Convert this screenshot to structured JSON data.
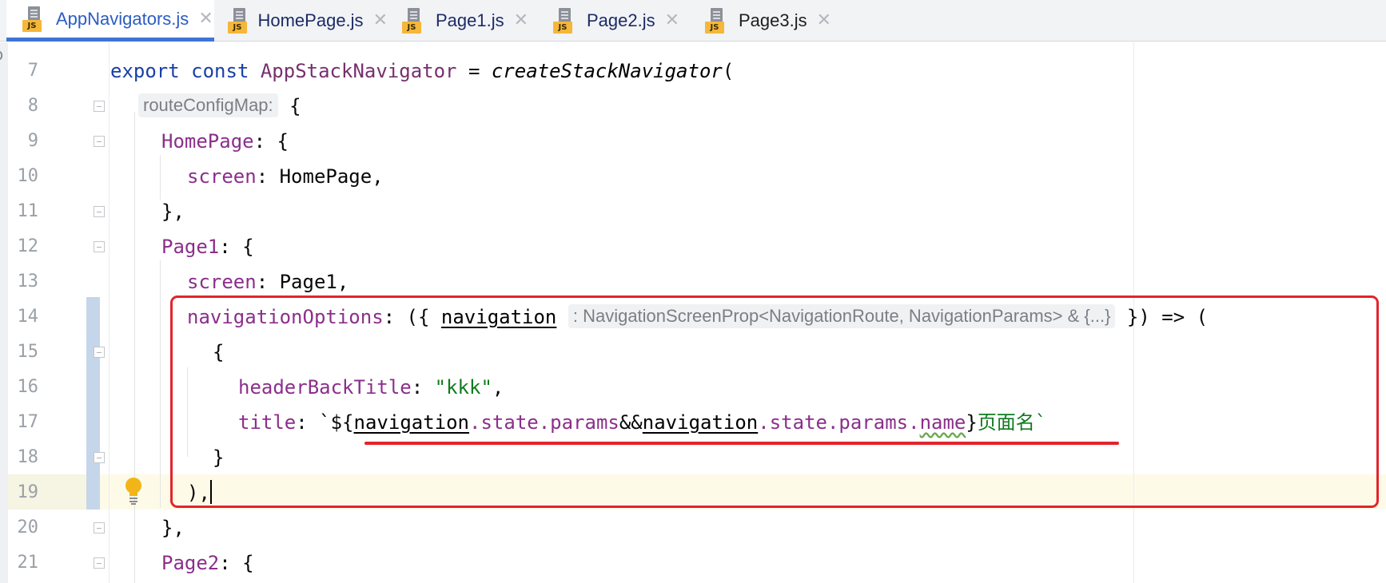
{
  "tabs": [
    {
      "label": "AppNavigators.js",
      "icon_badge": "JS",
      "active": true
    },
    {
      "label": "HomePage.js",
      "icon_badge": "JS",
      "active": false
    },
    {
      "label": "Page1.js",
      "icon_badge": "JS",
      "active": false
    },
    {
      "label": "Page2.js",
      "icon_badge": "JS",
      "active": false
    },
    {
      "label": "Page3.js",
      "icon_badge": "JS",
      "active": false
    }
  ],
  "tab_close_glyph": "✕",
  "editor": {
    "line_numbers": [
      "7",
      "8",
      "9",
      "10",
      "11",
      "12",
      "13",
      "14",
      "15",
      "16",
      "17",
      "18",
      "19",
      "20",
      "21"
    ],
    "current_line": "19",
    "lines": {
      "l7": {
        "kw1": "export",
        "kw2": "const",
        "ident": "AppStackNavigator",
        "eq": " = ",
        "fn": "createStackNavigator",
        "paren": "("
      },
      "l8": {
        "hint": "routeConfigMap:",
        "brace": "{"
      },
      "l9": {
        "key": "HomePage",
        "rest": ": {"
      },
      "l10": {
        "key": "screen",
        "rest": ": HomePage,"
      },
      "l11": {
        "text": "},"
      },
      "l12": {
        "key": "Page1",
        "rest": ": {"
      },
      "l13": {
        "key": "screen",
        "rest": ": Page1,"
      },
      "l14": {
        "key": "navigationOptions",
        "pre": ": ({ ",
        "param": "navigation",
        "hint": ": NavigationScreenProp<NavigationRoute, NavigationParams> & {...}",
        "post": " }) => ("
      },
      "l15": {
        "text": "{"
      },
      "l16": {
        "key": "headerBackTitle",
        "sep": ": ",
        "str": "\"kkk\"",
        "tail": ","
      },
      "l17": {
        "key": "title",
        "sep": ": ",
        "tick_open": "`${",
        "p1": "navigation",
        "c1": ".state.params",
        "and": "&&",
        "p2": "navigation",
        "c2": ".state.params.",
        "name": "name",
        "close": "}",
        "cjk": "页面名",
        "tick_close": "`"
      },
      "l18": {
        "text": "}"
      },
      "l19": {
        "text": "),"
      },
      "l20": {
        "text": "},"
      },
      "l21": {
        "key": "Page2",
        "rest": ": {"
      }
    }
  },
  "left_clipped_glyphs": [
    "o",
    "t"
  ],
  "annotation_colors": {
    "highlight_box": "#e3242b",
    "underline": "#e3242b"
  },
  "icons": {
    "tab_file": "js-file-icon",
    "intention": "lightbulb-icon",
    "fold": "fold-marker-icon"
  }
}
